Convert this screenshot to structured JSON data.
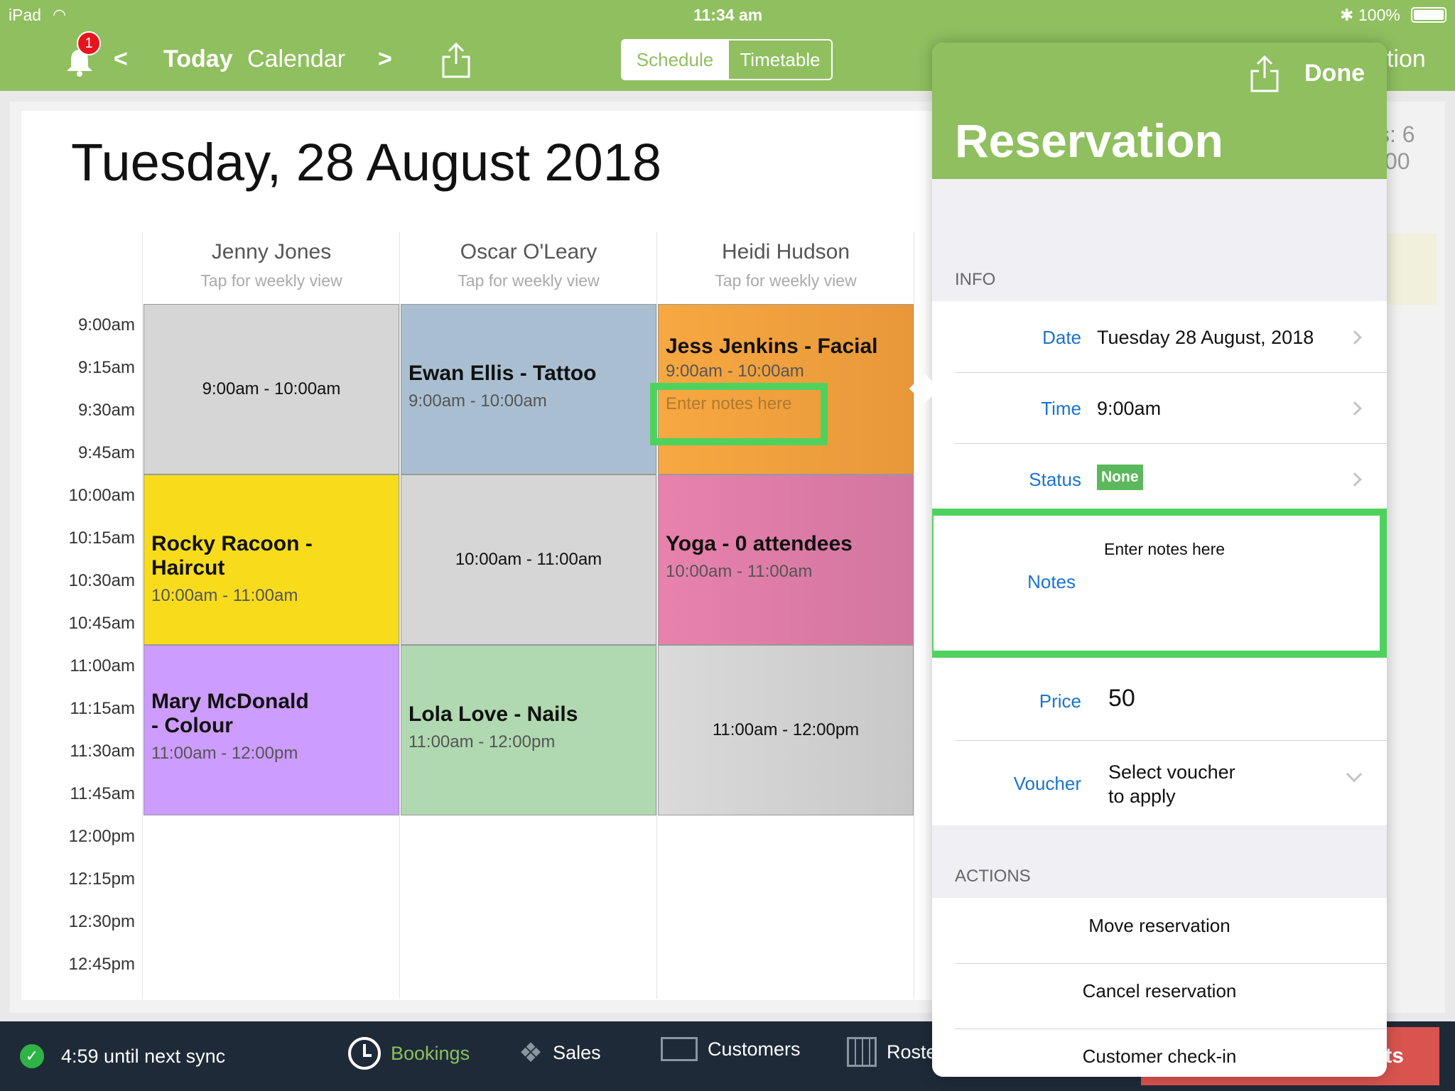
{
  "status_bar": {
    "device": "iPad",
    "time": "11:34 am",
    "battery": "100%"
  },
  "nav": {
    "badge_count": "1",
    "prev": "<",
    "today": "Today",
    "calendar": "Calendar",
    "next": ">",
    "segments": [
      "Schedule",
      "Timetable"
    ],
    "right_partial": "tion",
    "stats_partial_1": "s: 6",
    "stats_partial_2": ".00"
  },
  "page": {
    "date_title": "Tuesday, 28 August 2018"
  },
  "columns": [
    {
      "name": "Jenny Jones",
      "sub": "Tap for weekly view"
    },
    {
      "name": "Oscar O'Leary",
      "sub": "Tap for weekly view"
    },
    {
      "name": "Heidi Hudson",
      "sub": "Tap for weekly view"
    }
  ],
  "times": [
    "9:00am",
    "9:15am",
    "9:30am",
    "9:45am",
    "10:00am",
    "10:15am",
    "10:30am",
    "10:45am",
    "11:00am",
    "11:15am",
    "11:30am",
    "11:45am",
    "12:00pm",
    "12:15pm",
    "12:30pm",
    "12:45pm"
  ],
  "appointments": {
    "a1": {
      "range": "9:00am - 10:00am"
    },
    "a2": {
      "title": "Ewan Ellis - Tattoo",
      "range": "9:00am - 10:00am"
    },
    "a3": {
      "title": "Jess Jenkins - Facial",
      "range": "9:00am - 10:00am",
      "notes": "Enter notes here"
    },
    "a4": {
      "title": "Rocky Racoon - Haircut",
      "range": "10:00am - 11:00am"
    },
    "a5": {
      "range": "10:00am - 11:00am"
    },
    "a6": {
      "title": "Yoga - 0 attendees",
      "range": "10:00am - 11:00am"
    },
    "a7": {
      "title_line1": "Mary McDonald",
      "title_line2": "- Colour",
      "range": "11:00am - 12:00pm"
    },
    "a8": {
      "title": "Lola Love - Nails",
      "range": "11:00am - 12:00pm"
    },
    "a9": {
      "range": "11:00am - 12:00pm"
    }
  },
  "colors": {
    "nav_green": "#8fbf5f",
    "grey": "#d6d6d6",
    "blue": "#a9bfd1",
    "orange": "#f0a040",
    "yellow": "#f8dc1c",
    "pink": "#e07aa5",
    "purple": "#cc9cff",
    "green": "#b0d9b1",
    "highlight": "#4fd15e",
    "link_blue": "#1a73d1"
  },
  "bottom": {
    "sync": "4:59 until next sync",
    "tabs": [
      "Bookings",
      "Sales",
      "Customers",
      "Roste"
    ],
    "right_partial": "ts"
  },
  "popover": {
    "done": "Done",
    "title": "Reservation",
    "info_header": "INFO",
    "date_label": "Date",
    "date_value": "Tuesday 28 August, 2018",
    "time_label": "Time",
    "time_value": "9:00am",
    "status_label": "Status",
    "status_value": "None",
    "notes_label": "Notes",
    "notes_value": "Enter notes here",
    "price_label": "Price",
    "price_value": "50",
    "voucher_label": "Voucher",
    "voucher_line1": "Select voucher",
    "voucher_line2": "to apply",
    "actions_header": "ACTIONS",
    "actions": [
      "Move reservation",
      "Cancel reservation",
      "Customer check-in"
    ]
  }
}
